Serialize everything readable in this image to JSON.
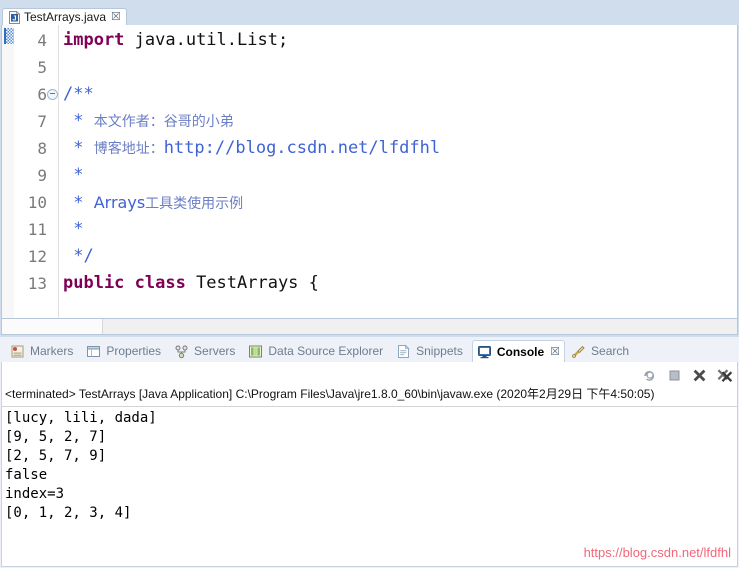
{
  "editor": {
    "tab": {
      "label": "TestArrays.java",
      "icon": "java-file-icon",
      "close": "☒"
    },
    "lines": [
      {
        "num": "4",
        "fold": false,
        "segments": [
          {
            "cls": "kw",
            "text": "import"
          },
          {
            "cls": "plain",
            "text": " java.util.List;"
          }
        ]
      },
      {
        "num": "5",
        "fold": false,
        "segments": []
      },
      {
        "num": "6",
        "fold": true,
        "segments": [
          {
            "cls": "cmt-code",
            "text": "/**"
          }
        ]
      },
      {
        "num": "7",
        "fold": false,
        "segments": [
          {
            "cls": "cmt-code",
            "text": " * "
          },
          {
            "cls": "cmt-cn",
            "text": "本文作者：谷哥的小弟"
          }
        ]
      },
      {
        "num": "8",
        "fold": false,
        "segments": [
          {
            "cls": "cmt-code",
            "text": " * "
          },
          {
            "cls": "cmt-cn",
            "text": "博客地址："
          },
          {
            "cls": "cmt-code",
            "text": "http://blog.csdn.net/lfdfhl"
          }
        ]
      },
      {
        "num": "9",
        "fold": false,
        "segments": [
          {
            "cls": "cmt-code",
            "text": " *"
          }
        ]
      },
      {
        "num": "10",
        "fold": false,
        "segments": [
          {
            "cls": "cmt-code",
            "text": " * "
          },
          {
            "cls": "cmt-arrays",
            "text": "Arrays"
          },
          {
            "cls": "cmt-cn",
            "text": "工具类使用示例"
          }
        ]
      },
      {
        "num": "11",
        "fold": false,
        "segments": [
          {
            "cls": "cmt-code",
            "text": " *"
          }
        ]
      },
      {
        "num": "12",
        "fold": false,
        "segments": [
          {
            "cls": "cmt-code",
            "text": " */"
          }
        ]
      },
      {
        "num": "13",
        "fold": false,
        "segments": [
          {
            "cls": "kw",
            "text": "public class"
          },
          {
            "cls": "plain",
            "text": " TestArrays {"
          }
        ]
      }
    ],
    "scroll_left_arrow": "‹"
  },
  "views": {
    "tabs": [
      {
        "label": "Markers",
        "icon": "markers-icon",
        "active": false
      },
      {
        "label": "Properties",
        "icon": "properties-icon",
        "active": false
      },
      {
        "label": "Servers",
        "icon": "servers-icon",
        "active": false
      },
      {
        "label": "Data Source Explorer",
        "icon": "database-icon",
        "active": false
      },
      {
        "label": "Snippets",
        "icon": "snippets-icon",
        "active": false
      },
      {
        "label": "Console",
        "icon": "console-icon",
        "active": true,
        "close": "☒"
      },
      {
        "label": "Search",
        "icon": "search-icon",
        "active": false
      }
    ]
  },
  "console": {
    "toolbar": [
      {
        "name": "relaunch-icon",
        "glyph": "↻"
      },
      {
        "name": "terminate-icon",
        "glyph": "■"
      },
      {
        "name": "remove-icon",
        "glyph": "✕"
      },
      {
        "name": "remove-all-icon",
        "glyph": "✕"
      }
    ],
    "status": "<terminated> TestArrays [Java Application] C:\\Program Files\\Java\\jre1.8.0_60\\bin\\javaw.exe (2020年2月29日 下午4:50:05)",
    "output": [
      "[lucy, lili, dada]",
      "[9, 5, 2, 7]",
      "[2, 5, 7, 9]",
      "false",
      "index=3",
      "[0, 1, 2, 3, 4]"
    ]
  },
  "watermark": {
    "text": "https://blog.csdn.net/lfdfhl",
    "color": "#f4667a"
  }
}
